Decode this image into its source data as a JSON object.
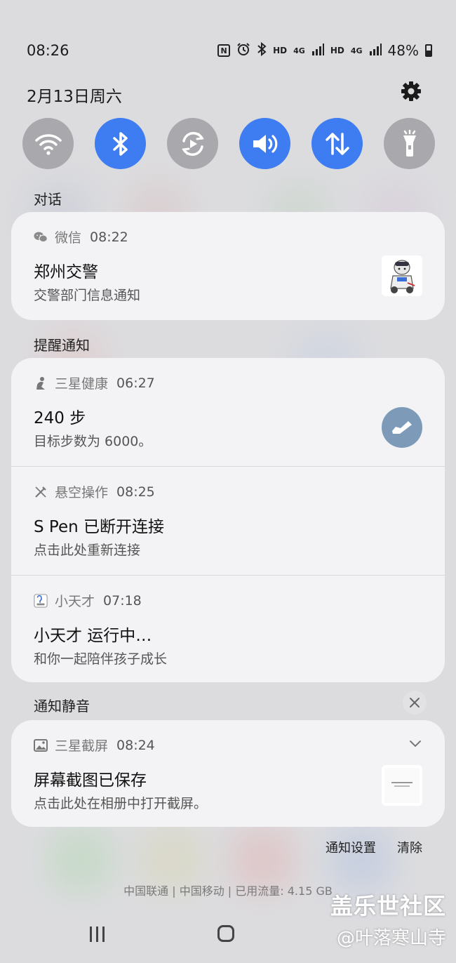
{
  "status_bar": {
    "time": "08:26",
    "hd1": "HD",
    "net1": "4G",
    "hd2": "HD",
    "net2": "4G",
    "battery": "48%",
    "battery_level": 0.48
  },
  "header": {
    "date": "2月13日周六"
  },
  "quick_settings": [
    {
      "name": "wifi",
      "icon": "wifi-icon",
      "on": false
    },
    {
      "name": "bluetooth",
      "icon": "bluetooth-icon",
      "on": true
    },
    {
      "name": "auto-rotate",
      "icon": "rotate-icon",
      "on": false
    },
    {
      "name": "sound",
      "icon": "volume-icon",
      "on": true
    },
    {
      "name": "mobile-data",
      "icon": "data-arrows-icon",
      "on": true
    },
    {
      "name": "flashlight",
      "icon": "flashlight-icon",
      "on": false
    }
  ],
  "sections": {
    "conversation": "对话",
    "alerts": "提醒通知",
    "silent": "通知静音"
  },
  "conversation": {
    "app": "微信",
    "time": "08:22",
    "title": "郑州交警",
    "text": "交警部门信息通知"
  },
  "alerts": [
    {
      "app": "三星健康",
      "time": "06:27",
      "title": "240 步",
      "text": "目标步数为 6000。",
      "icon": "health-icon"
    },
    {
      "app": "悬空操作",
      "time": "08:25",
      "title": "S Pen 已断开连接",
      "text": "点击此处重新连接",
      "icon": "pen-icon"
    },
    {
      "app": "小天才",
      "time": "07:18",
      "title": "小天才 运行中…",
      "text": "和你一起陪伴孩子成长",
      "icon": "xtc-icon"
    }
  ],
  "silent": {
    "app": "三星截屏",
    "time": "08:24",
    "title": "屏幕截图已保存",
    "text": "点击此处在相册中打开截屏。"
  },
  "footer": {
    "settings": "通知设置",
    "clear": "清除",
    "carrier": "中国联通 | 中国移动 | 已用流量: 4.15 GB"
  },
  "watermark": {
    "line1": "盖乐世社区",
    "line2": "@叶落寒山寺"
  },
  "colors": {
    "accent": "#3e7cf2",
    "toggle_off": "#a9a9ad",
    "card": "#f3f3f5"
  }
}
